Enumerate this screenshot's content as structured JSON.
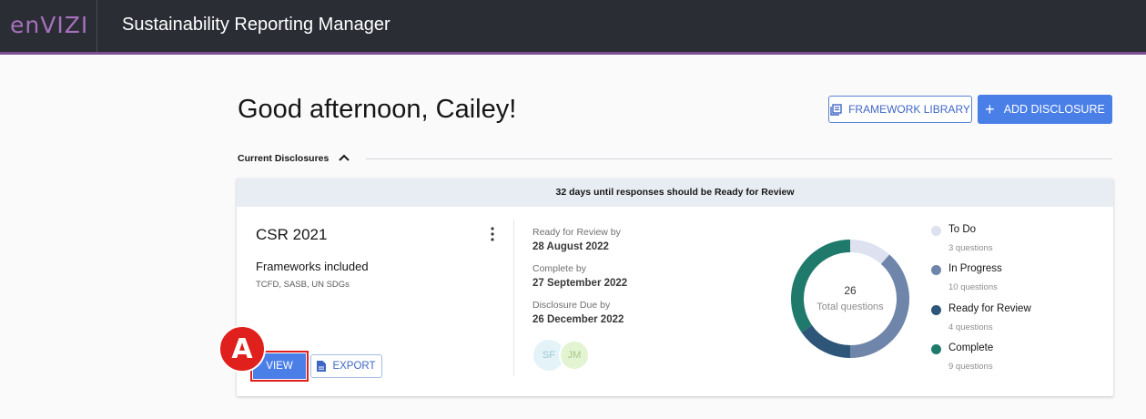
{
  "app": {
    "logo": "enVIZI",
    "title": "Sustainability Reporting Manager"
  },
  "page": {
    "greeting": "Good afternoon, Cailey!",
    "framework_library_label": "FRAMEWORK LIBRARY",
    "add_disclosure_label": "ADD DISCLOSURE",
    "section_label": "Current Disclosures"
  },
  "disclosure": {
    "banner": "32 days until responses should be Ready for Review",
    "title": "CSR 2021",
    "frameworks_label": "Frameworks included",
    "frameworks": "TCFD, SASB, UN SDGs",
    "view_label": "VIEW",
    "export_label": "EXPORT",
    "dates": [
      {
        "label": "Ready for Review by",
        "value": "28 August 2022"
      },
      {
        "label": "Complete by",
        "value": "27 September 2022"
      },
      {
        "label": "Disclosure Due by",
        "value": "26 December 2022"
      }
    ],
    "avatars": [
      "SF",
      "JM"
    ],
    "total": "26",
    "total_label": "Total questions",
    "status": [
      {
        "name": "To Do",
        "count": "3 questions",
        "value": 3,
        "color": "#dde1f0"
      },
      {
        "name": "In Progress",
        "count": "10 questions",
        "value": 10,
        "color": "#6f86aa"
      },
      {
        "name": "Ready for Review",
        "count": "4 questions",
        "value": 4,
        "color": "#2e5678"
      },
      {
        "name": "Complete",
        "count": "9 questions",
        "value": 9,
        "color": "#1f7a6c"
      }
    ]
  },
  "annotation": {
    "marker": "A"
  }
}
